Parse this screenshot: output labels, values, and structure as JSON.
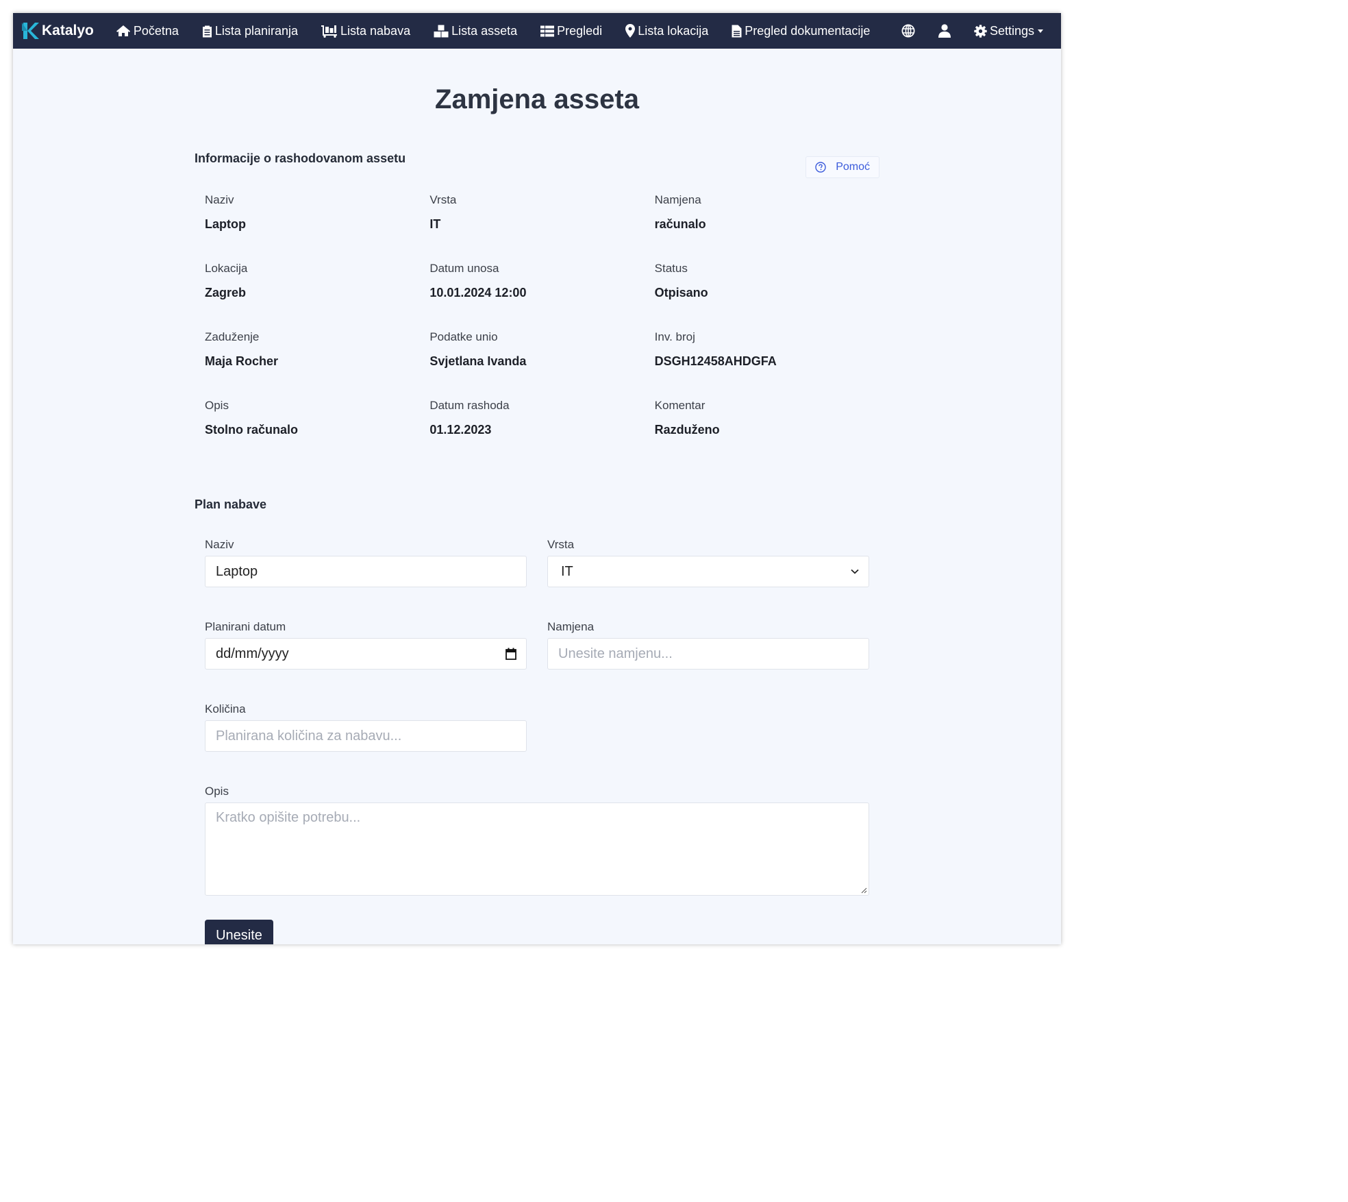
{
  "nav": {
    "brand": "Katalyo",
    "items": [
      {
        "label": "Početna",
        "icon": "home-icon"
      },
      {
        "label": "Lista planiranja",
        "icon": "clipboard-icon"
      },
      {
        "label": "Lista nabava",
        "icon": "dolly-icon"
      },
      {
        "label": "Lista asseta",
        "icon": "boxes-icon"
      },
      {
        "label": "Pregledi",
        "icon": "table-icon"
      },
      {
        "label": "Lista lokacija",
        "icon": "map-marker-icon"
      },
      {
        "label": "Pregled dokumentacije",
        "icon": "file-icon"
      }
    ],
    "settings_label": "Settings"
  },
  "page": {
    "title": "Zamjena asseta",
    "help_label": "Pomoć"
  },
  "info": {
    "section_title": "Informacije o rashodovanom assetu",
    "fields": [
      {
        "label": "Naziv",
        "value": "Laptop"
      },
      {
        "label": "Vrsta",
        "value": "IT"
      },
      {
        "label": "Namjena",
        "value": "računalo"
      },
      {
        "label": "Lokacija",
        "value": "Zagreb"
      },
      {
        "label": "Datum unosa",
        "value": "10.01.2024 12:00"
      },
      {
        "label": "Status",
        "value": "Otpisano"
      },
      {
        "label": "Zaduženje",
        "value": "Maja Rocher"
      },
      {
        "label": "Podatke unio",
        "value": "Svjetlana Ivanda"
      },
      {
        "label": "Inv. broj",
        "value": "DSGH12458AHDGFA"
      },
      {
        "label": "Opis",
        "value": "Stolno računalo"
      },
      {
        "label": "Datum rashoda",
        "value": "01.12.2023"
      },
      {
        "label": "Komentar",
        "value": "Razduženo"
      }
    ]
  },
  "plan": {
    "section_title": "Plan nabave",
    "naziv": {
      "label": "Naziv",
      "value": "Laptop"
    },
    "vrsta": {
      "label": "Vrsta",
      "value": "IT"
    },
    "datum": {
      "label": "Planirani datum",
      "value": "dd/mm/yyyy"
    },
    "namjena": {
      "label": "Namjena",
      "placeholder": "Unesite namjenu..."
    },
    "kolicina": {
      "label": "Količina",
      "placeholder": "Planirana količina za nabavu..."
    },
    "opis": {
      "label": "Opis",
      "placeholder": "Kratko opišite potrebu..."
    },
    "submit_label": "Unesite"
  }
}
